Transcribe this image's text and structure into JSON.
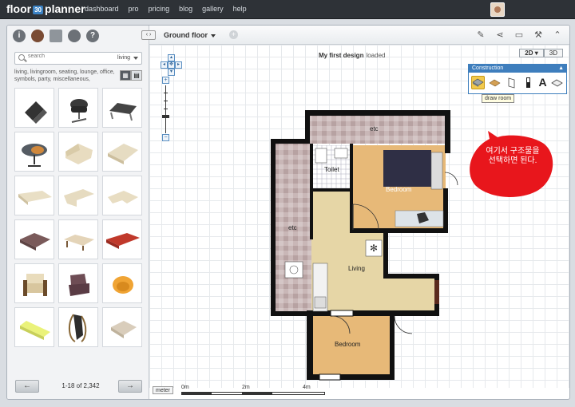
{
  "app": {
    "logo_left": "floor",
    "logo_badge": "30",
    "logo_right": "planner"
  },
  "nav": [
    "dashboard",
    "pro",
    "pricing",
    "blog",
    "gallery",
    "help"
  ],
  "sidebar": {
    "search_placeholder": "search",
    "category": "living",
    "tags": "living, livingroom, seating, lounge, office, symbols, party, miscellaneous,",
    "items": [
      "laptop",
      "office-chair",
      "deck-chair",
      "round-table",
      "loveseat",
      "sofa",
      "long-sofa",
      "corner-sofa",
      "corner-sofa-2",
      "brown-sofa",
      "chaise",
      "red-sofa",
      "armchair",
      "dark-armchair",
      "orange-round-chair",
      "chaise-lounge",
      "wood-lounge-chair",
      "beige-armchair"
    ],
    "pager": {
      "prev": "←",
      "next": "→",
      "range": "1-18 of 2,342"
    }
  },
  "toolbar": {
    "collapse": "‹ ›",
    "floor": "Ground floor",
    "add_floor": "+"
  },
  "design": {
    "title": "My first design",
    "status": "loaded"
  },
  "mode": {
    "twoD": "2D ▾",
    "threeD": "3D"
  },
  "construction": {
    "title": "Construction",
    "close": "▲",
    "tools": [
      "draw-room-tool",
      "floor-tool",
      "door-tool",
      "window-tool",
      "text-tool",
      "measure-tool"
    ],
    "tooltip": "draw room"
  },
  "annotation": "여기서 구조물을 선택하면 된다.",
  "rooms": {
    "etc_top": "etc",
    "toilet": "Toilet",
    "bedroom1": "Bedroom",
    "etc_left": "etc",
    "living": "Living",
    "bedroom2": "Bedroom"
  },
  "scale": {
    "unit": "meter",
    "m0": "0m",
    "m2": "2m",
    "m4": "4m"
  },
  "colors": {
    "accent": "#3e7ebd",
    "topbar": "#2e3237",
    "bubble": "#e8161c",
    "wood": "#e7b978",
    "beige": "#e6d6a6"
  }
}
